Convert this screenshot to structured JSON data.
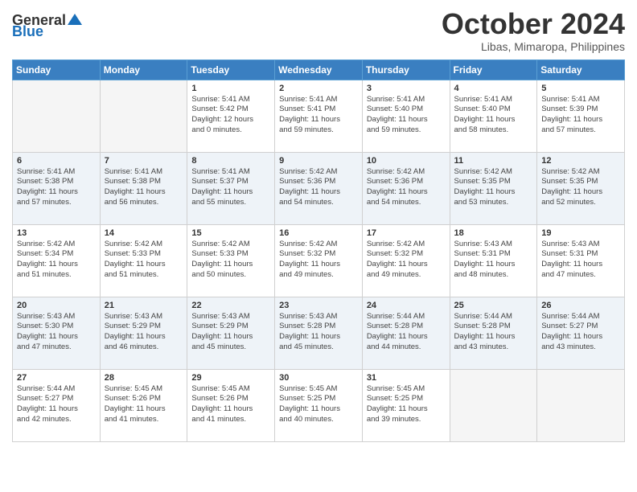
{
  "header": {
    "logo_general": "General",
    "logo_blue": "Blue",
    "month": "October 2024",
    "location": "Libas, Mimaropa, Philippines"
  },
  "days_of_week": [
    "Sunday",
    "Monday",
    "Tuesday",
    "Wednesday",
    "Thursday",
    "Friday",
    "Saturday"
  ],
  "weeks": [
    [
      {
        "day": "",
        "info": ""
      },
      {
        "day": "",
        "info": ""
      },
      {
        "day": "1",
        "info": "Sunrise: 5:41 AM\nSunset: 5:42 PM\nDaylight: 12 hours\nand 0 minutes."
      },
      {
        "day": "2",
        "info": "Sunrise: 5:41 AM\nSunset: 5:41 PM\nDaylight: 11 hours\nand 59 minutes."
      },
      {
        "day": "3",
        "info": "Sunrise: 5:41 AM\nSunset: 5:40 PM\nDaylight: 11 hours\nand 59 minutes."
      },
      {
        "day": "4",
        "info": "Sunrise: 5:41 AM\nSunset: 5:40 PM\nDaylight: 11 hours\nand 58 minutes."
      },
      {
        "day": "5",
        "info": "Sunrise: 5:41 AM\nSunset: 5:39 PM\nDaylight: 11 hours\nand 57 minutes."
      }
    ],
    [
      {
        "day": "6",
        "info": "Sunrise: 5:41 AM\nSunset: 5:38 PM\nDaylight: 11 hours\nand 57 minutes."
      },
      {
        "day": "7",
        "info": "Sunrise: 5:41 AM\nSunset: 5:38 PM\nDaylight: 11 hours\nand 56 minutes."
      },
      {
        "day": "8",
        "info": "Sunrise: 5:41 AM\nSunset: 5:37 PM\nDaylight: 11 hours\nand 55 minutes."
      },
      {
        "day": "9",
        "info": "Sunrise: 5:42 AM\nSunset: 5:36 PM\nDaylight: 11 hours\nand 54 minutes."
      },
      {
        "day": "10",
        "info": "Sunrise: 5:42 AM\nSunset: 5:36 PM\nDaylight: 11 hours\nand 54 minutes."
      },
      {
        "day": "11",
        "info": "Sunrise: 5:42 AM\nSunset: 5:35 PM\nDaylight: 11 hours\nand 53 minutes."
      },
      {
        "day": "12",
        "info": "Sunrise: 5:42 AM\nSunset: 5:35 PM\nDaylight: 11 hours\nand 52 minutes."
      }
    ],
    [
      {
        "day": "13",
        "info": "Sunrise: 5:42 AM\nSunset: 5:34 PM\nDaylight: 11 hours\nand 51 minutes."
      },
      {
        "day": "14",
        "info": "Sunrise: 5:42 AM\nSunset: 5:33 PM\nDaylight: 11 hours\nand 51 minutes."
      },
      {
        "day": "15",
        "info": "Sunrise: 5:42 AM\nSunset: 5:33 PM\nDaylight: 11 hours\nand 50 minutes."
      },
      {
        "day": "16",
        "info": "Sunrise: 5:42 AM\nSunset: 5:32 PM\nDaylight: 11 hours\nand 49 minutes."
      },
      {
        "day": "17",
        "info": "Sunrise: 5:42 AM\nSunset: 5:32 PM\nDaylight: 11 hours\nand 49 minutes."
      },
      {
        "day": "18",
        "info": "Sunrise: 5:43 AM\nSunset: 5:31 PM\nDaylight: 11 hours\nand 48 minutes."
      },
      {
        "day": "19",
        "info": "Sunrise: 5:43 AM\nSunset: 5:31 PM\nDaylight: 11 hours\nand 47 minutes."
      }
    ],
    [
      {
        "day": "20",
        "info": "Sunrise: 5:43 AM\nSunset: 5:30 PM\nDaylight: 11 hours\nand 47 minutes."
      },
      {
        "day": "21",
        "info": "Sunrise: 5:43 AM\nSunset: 5:29 PM\nDaylight: 11 hours\nand 46 minutes."
      },
      {
        "day": "22",
        "info": "Sunrise: 5:43 AM\nSunset: 5:29 PM\nDaylight: 11 hours\nand 45 minutes."
      },
      {
        "day": "23",
        "info": "Sunrise: 5:43 AM\nSunset: 5:28 PM\nDaylight: 11 hours\nand 45 minutes."
      },
      {
        "day": "24",
        "info": "Sunrise: 5:44 AM\nSunset: 5:28 PM\nDaylight: 11 hours\nand 44 minutes."
      },
      {
        "day": "25",
        "info": "Sunrise: 5:44 AM\nSunset: 5:28 PM\nDaylight: 11 hours\nand 43 minutes."
      },
      {
        "day": "26",
        "info": "Sunrise: 5:44 AM\nSunset: 5:27 PM\nDaylight: 11 hours\nand 43 minutes."
      }
    ],
    [
      {
        "day": "27",
        "info": "Sunrise: 5:44 AM\nSunset: 5:27 PM\nDaylight: 11 hours\nand 42 minutes."
      },
      {
        "day": "28",
        "info": "Sunrise: 5:45 AM\nSunset: 5:26 PM\nDaylight: 11 hours\nand 41 minutes."
      },
      {
        "day": "29",
        "info": "Sunrise: 5:45 AM\nSunset: 5:26 PM\nDaylight: 11 hours\nand 41 minutes."
      },
      {
        "day": "30",
        "info": "Sunrise: 5:45 AM\nSunset: 5:25 PM\nDaylight: 11 hours\nand 40 minutes."
      },
      {
        "day": "31",
        "info": "Sunrise: 5:45 AM\nSunset: 5:25 PM\nDaylight: 11 hours\nand 39 minutes."
      },
      {
        "day": "",
        "info": ""
      },
      {
        "day": "",
        "info": ""
      }
    ]
  ]
}
